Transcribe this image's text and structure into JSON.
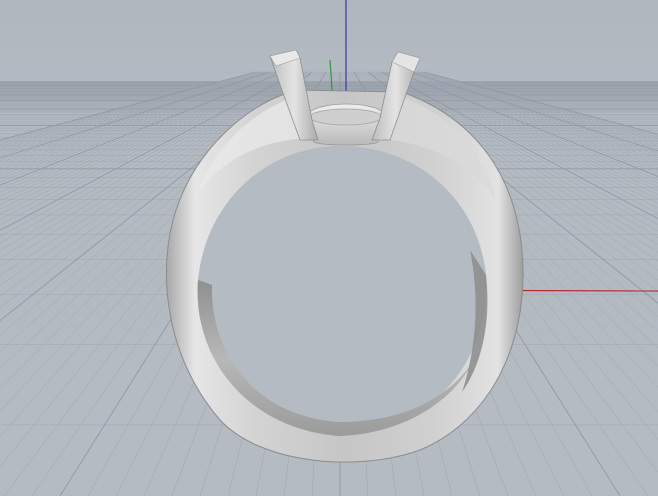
{
  "viewport": {
    "projection": "perspective",
    "background_color": "#b4bac2",
    "grid_color": "#9ea6b0",
    "grid_major_color": "#8f98a3"
  },
  "axes": {
    "x_axis_color": "#b8282c",
    "y_axis_color": "#2f9a3c",
    "z_axis_color": "#2e3bb0"
  },
  "object": {
    "icon": "ring-model-icon",
    "material_color": "#d9d9d9"
  }
}
